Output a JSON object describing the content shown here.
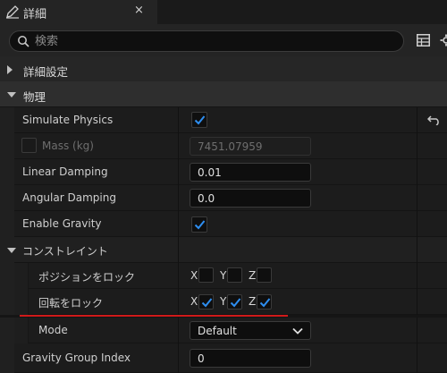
{
  "tab": {
    "title": "詳細",
    "icon": "pencil-icon",
    "close_glyph": "×"
  },
  "search": {
    "placeholder": "検索"
  },
  "categories": {
    "details_settings": "詳細設定",
    "physics": "物理",
    "constraints": "コンストレイント"
  },
  "properties": {
    "simulate_physics": {
      "label": "Simulate Physics",
      "checked": true
    },
    "mass": {
      "label": "Mass (kg)",
      "value": "7451.07959",
      "enabled": false,
      "checked": false
    },
    "linear_damping": {
      "label": "Linear Damping",
      "value": "0.01"
    },
    "angular_damping": {
      "label": "Angular Damping",
      "value": "0.0"
    },
    "enable_gravity": {
      "label": "Enable Gravity",
      "checked": true
    },
    "lock_position": {
      "label": "ポジションをロック",
      "x": false,
      "y": false,
      "z": false
    },
    "lock_rotation": {
      "label": "回転をロック",
      "x": true,
      "y": true,
      "z": true
    },
    "mode": {
      "label": "Mode",
      "value": "Default"
    },
    "gravity_group_index": {
      "label": "Gravity Group Index",
      "value": "0"
    }
  },
  "axes": {
    "x": "X",
    "y": "Y",
    "z": "Z"
  },
  "colors": {
    "accent_check": "#2e8ef0",
    "annotation_underline": "#d01a1a"
  }
}
